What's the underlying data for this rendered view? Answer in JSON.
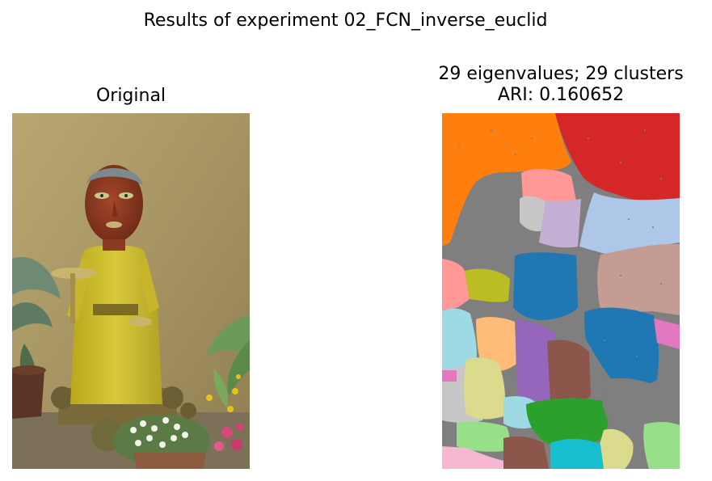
{
  "figure": {
    "suptitle": "Results of experiment 02_FCN_inverse_euclid"
  },
  "panels": [
    {
      "title": "Original",
      "content": "photo"
    },
    {
      "title_line1": "29 eigenvalues; 29 clusters",
      "title_line2": "ARI: 0.160652",
      "content": "segmentation"
    }
  ],
  "colors": {
    "orange": "#ff7f0e",
    "red": "#d62728",
    "gray": "#7f7f7f",
    "light_blue": "#aec7e8",
    "rosy_brown": "#c49c94",
    "blue": "#1f77b4",
    "olive": "#bcbd22",
    "light_cyan": "#9edae5",
    "peach": "#ffbb78",
    "purple": "#9467bd",
    "brown": "#8c564b",
    "lilac": "#c5b0d5",
    "pink": "#ff9896",
    "light_gray": "#c7c7c7",
    "magenta": "#e377c2",
    "green": "#2ca02c",
    "light_green": "#98df8a",
    "khaki": "#dbdb8d",
    "cyan": "#17becf",
    "light_pink": "#f7b6d2"
  }
}
